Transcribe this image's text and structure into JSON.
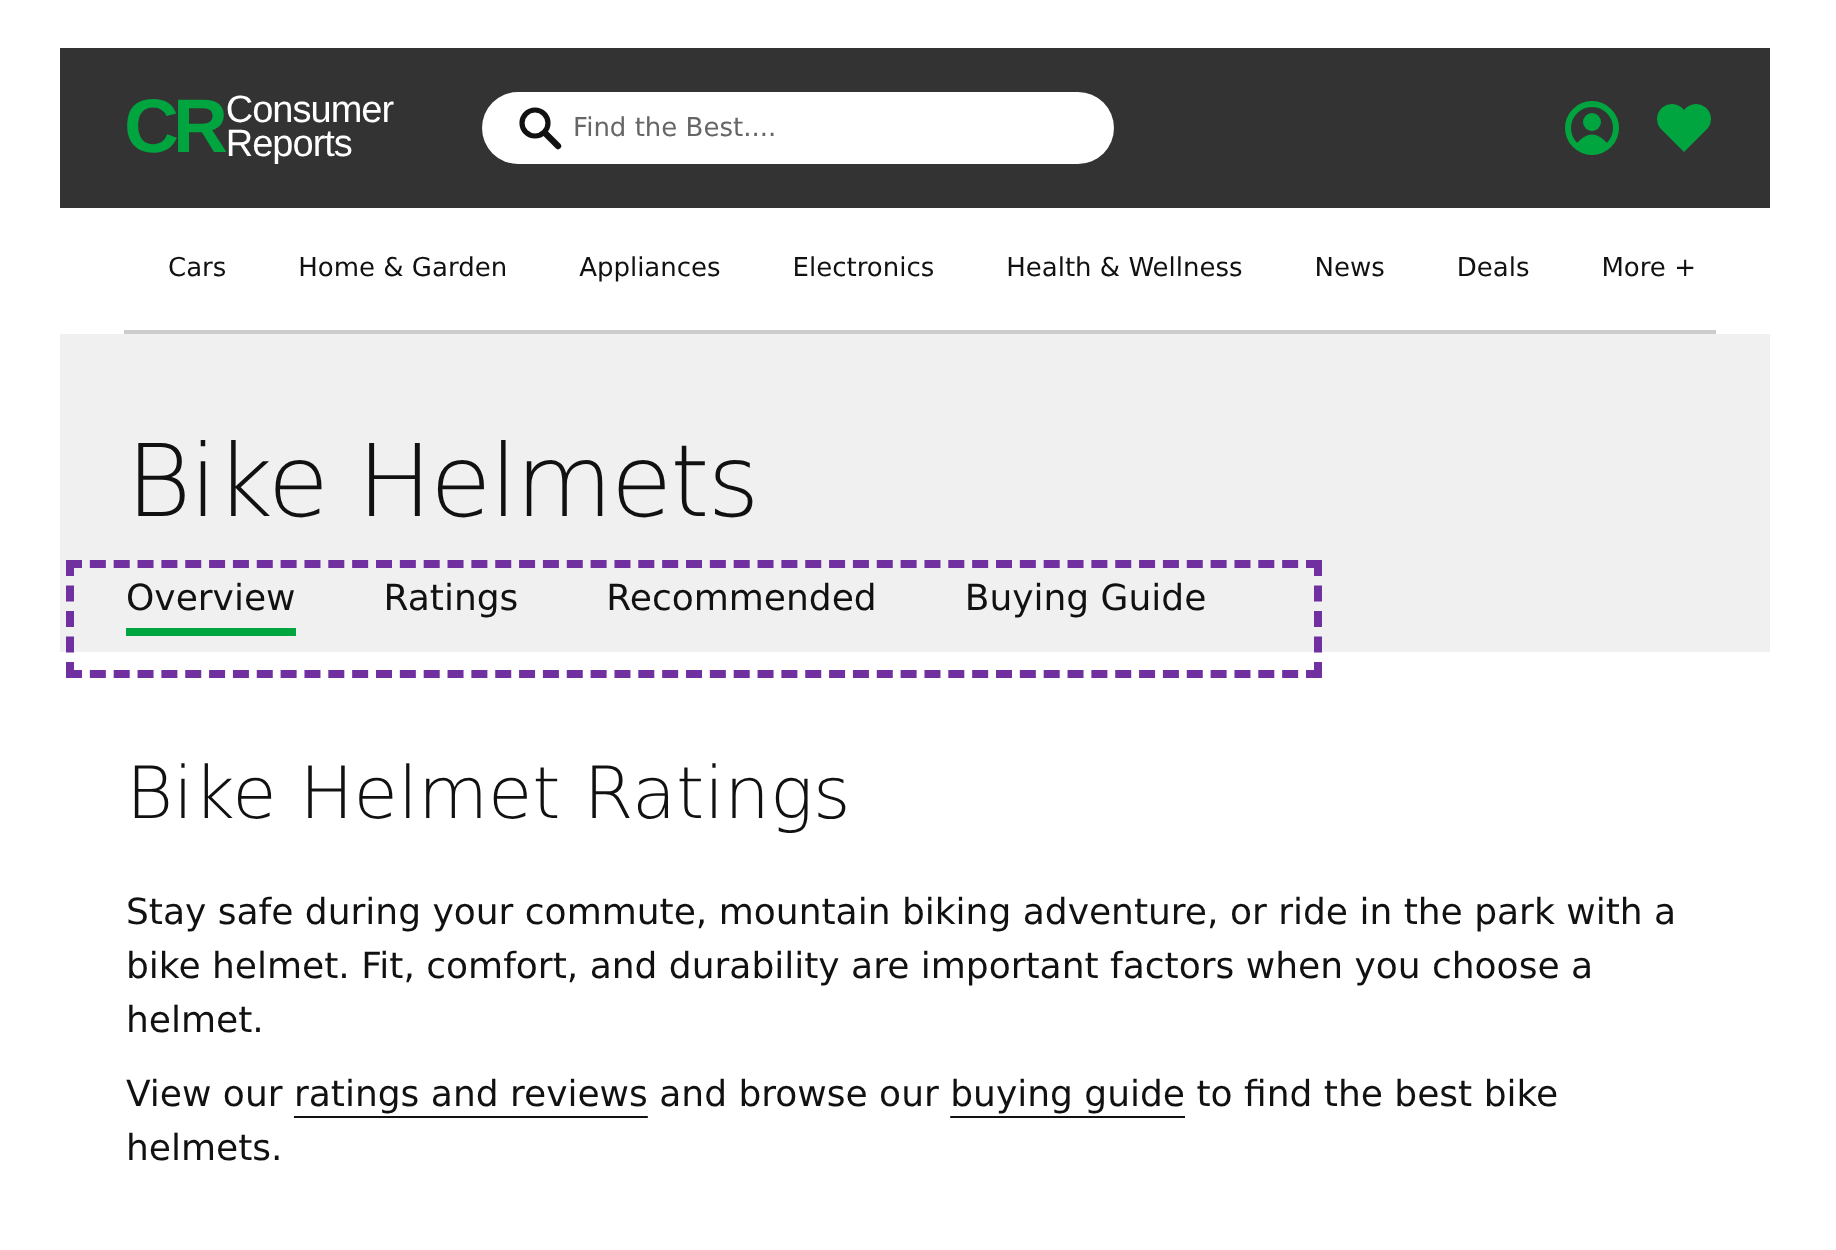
{
  "header": {
    "logo": {
      "mark": "CR",
      "lines": [
        "Consumer",
        "Reports"
      ]
    },
    "search": {
      "placeholder": "Find the Best...."
    }
  },
  "nav": {
    "items": [
      "Cars",
      "Home & Garden",
      "Appliances",
      "Electronics",
      "Health & Wellness",
      "News",
      "Deals",
      "More +"
    ]
  },
  "page": {
    "title": "Bike Helmets",
    "tabs": [
      {
        "label": "Overview",
        "selected": true
      },
      {
        "label": "Ratings",
        "selected": false
      },
      {
        "label": "Recommended",
        "selected": false
      },
      {
        "label": "Buying Guide",
        "selected": false
      }
    ],
    "highlight": {
      "color": "#7030a0"
    }
  },
  "content": {
    "heading": "Bike Helmet Ratings",
    "paragraphs": [
      [
        {
          "kind": "text",
          "text": "Stay safe during your commute, mountain biking adventure, or ride in the park with a bike helmet. Fit, comfort, and durability are important factors when you choose a helmet."
        }
      ],
      [
        {
          "kind": "text",
          "text": "View our "
        },
        {
          "kind": "link",
          "text": "ratings and reviews"
        },
        {
          "kind": "text",
          "text": " and browse our "
        },
        {
          "kind": "link",
          "text": "buying guide"
        },
        {
          "kind": "text",
          "text": " to find the best bike helmets."
        }
      ]
    ]
  }
}
